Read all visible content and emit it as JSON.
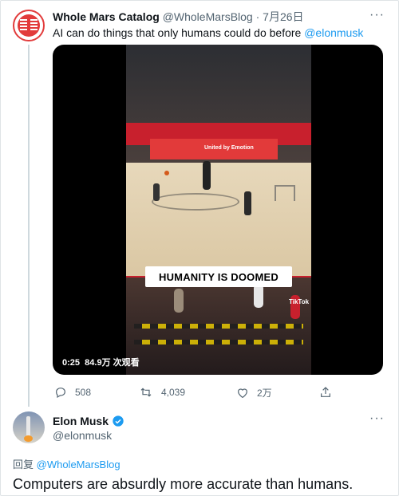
{
  "tweet1": {
    "author_name": "Whole Mars Catalog",
    "author_handle": "@WholeMarsBlog",
    "separator": "·",
    "date": "7月26日",
    "text_prefix": "AI can do things that only humans could do before ",
    "mention": "@elonmusk",
    "video": {
      "caption": "HUMANITY IS DOOMED",
      "banner_text": "United by Emotion",
      "watermark": "TikTok",
      "duration": "0:25",
      "views": "84.9万 次观看"
    },
    "actions": {
      "reply_count": "508",
      "retweet_count": "4,039",
      "like_count": "2万"
    },
    "more_label": "···"
  },
  "tweet2": {
    "author_name": "Elon Musk",
    "author_handle": "@elonmusk",
    "reply_prefix": "回复 ",
    "reply_to": "@WholeMarsBlog",
    "text": "Computers are absurdly more accurate than humans.",
    "more_label": "···"
  },
  "colors": {
    "link": "#1d9bf0",
    "muted": "#536471",
    "text": "#0f1419",
    "verified": "#1d9bf0"
  },
  "icons": {
    "reply": "reply-icon",
    "retweet": "retweet-icon",
    "like": "heart-icon",
    "share": "share-icon",
    "verified": "verified-badge-icon"
  }
}
